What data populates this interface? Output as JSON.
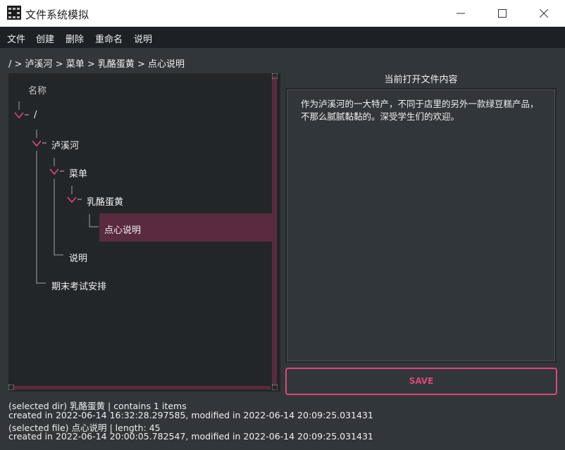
{
  "window": {
    "title": "文件系统模拟"
  },
  "menu": [
    "文件",
    "创建",
    "删除",
    "重命名",
    "说明"
  ],
  "breadcrumb": "/ > 泸溪河 > 菜单 > 乳酪蛋黄 > 点心说明",
  "tree": {
    "header": "名称",
    "nodes": [
      {
        "label": "/",
        "expanded": true
      },
      {
        "label": "泸溪河",
        "expanded": true
      },
      {
        "label": "菜单",
        "expanded": true
      },
      {
        "label": "乳酪蛋黄",
        "expanded": true
      },
      {
        "label": "点心说明",
        "selected": true
      },
      {
        "label": "说明"
      },
      {
        "label": "期末考试安排"
      }
    ]
  },
  "content": {
    "title": "当前打开文件内容",
    "text": "作为泸溪河的一大特产，不同于店里的另外一款绿豆糕产品，不那么腻腻黏黏的。深受学生们的欢迎。",
    "save_label": "SAVE"
  },
  "status": {
    "line1": "(selected dir) 乳酪蛋黄   |   contains 1 items",
    "line2": "created in 2022-06-14 16:32:28.297585, modified in 2022-06-14 20:09:25.031431",
    "line3": "(selected file) 点心说明   |   length: 45",
    "line4": "created in 2022-06-14 20:00:05.782547, modified in 2022-06-14 20:09:25.031431"
  },
  "colors": {
    "accent": "#e0457b",
    "selection": "#5a2b40",
    "background": "#31363b",
    "panel": "#232629"
  },
  "icons": [
    "app-icon",
    "minimize-icon",
    "maximize-icon",
    "close-icon",
    "chevron-down-icon"
  ]
}
